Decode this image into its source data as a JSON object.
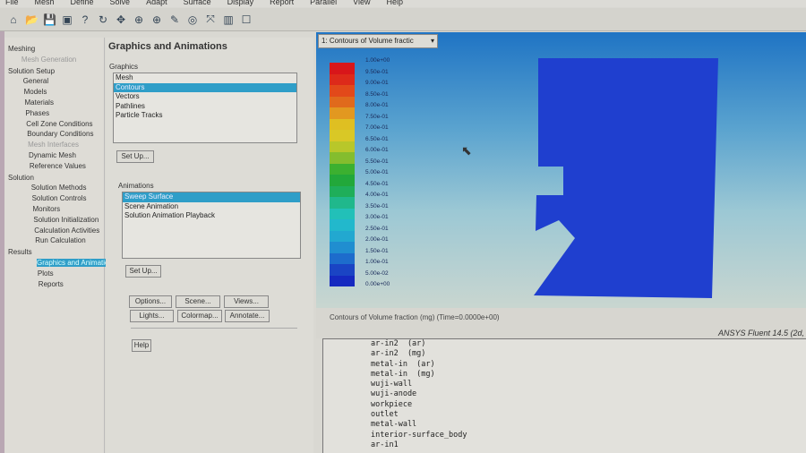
{
  "menu": [
    "File",
    "Mesh",
    "Define",
    "Solve",
    "Adapt",
    "Surface",
    "Display",
    "Report",
    "Parallel",
    "View",
    "Help"
  ],
  "toolbar_icons": [
    "home-icon",
    "open-icon",
    "save-icon",
    "image-icon",
    "help-icon",
    "rotate-icon",
    "pan-icon",
    "zoom-in-icon",
    "zoom-fit-icon",
    "probe-icon",
    "zoom-box-icon",
    "axes-icon",
    "layout-icon",
    "window-icon"
  ],
  "tree": [
    {
      "label": "Meshing",
      "level": 0
    },
    {
      "label": "Mesh Generation",
      "level": 1,
      "disabled": true
    },
    {
      "label": "Solution Setup",
      "level": 0
    },
    {
      "label": "General",
      "level": 1
    },
    {
      "label": "Models",
      "level": 1
    },
    {
      "label": "Materials",
      "level": 1
    },
    {
      "label": "Phases",
      "level": 1
    },
    {
      "label": "Cell Zone Conditions",
      "level": 1
    },
    {
      "label": "Boundary Conditions",
      "level": 1
    },
    {
      "label": "Mesh Interfaces",
      "level": 1,
      "disabled": true
    },
    {
      "label": "Dynamic Mesh",
      "level": 1
    },
    {
      "label": "Reference Values",
      "level": 1
    },
    {
      "label": "Solution",
      "level": 0
    },
    {
      "label": "Solution Methods",
      "level": 1
    },
    {
      "label": "Solution Controls",
      "level": 1
    },
    {
      "label": "Monitors",
      "level": 1
    },
    {
      "label": "Solution Initialization",
      "level": 1
    },
    {
      "label": "Calculation Activities",
      "level": 1
    },
    {
      "label": "Run Calculation",
      "level": 1
    },
    {
      "label": "Results",
      "level": 0
    },
    {
      "label": "Graphics and Animations",
      "level": 1,
      "selected": true
    },
    {
      "label": "Plots",
      "level": 1
    },
    {
      "label": "Reports",
      "level": 1
    }
  ],
  "panel": {
    "title": "Graphics and Animations",
    "graphics_label": "Graphics",
    "graphics_items": [
      "Mesh",
      "Contours",
      "Vectors",
      "Pathlines",
      "Particle Tracks"
    ],
    "graphics_selected": 1,
    "setup1": "Set Up...",
    "animations_label": "Animations",
    "animation_items": [
      "Sweep Surface",
      "Scene Animation",
      "Solution Animation Playback"
    ],
    "animation_selected": 0,
    "setup2": "Set Up...",
    "options": "Options...",
    "scene": "Scene...",
    "views": "Views...",
    "lights": "Lights...",
    "colormap": "Colormap...",
    "annotate": "Annotate...",
    "help": "Help"
  },
  "graphics": {
    "window_select": "1: Contours of Volume fractic",
    "colorbar_labels": [
      "1.00e+00",
      "9.50e-01",
      "9.00e-01",
      "8.50e-01",
      "8.00e-01",
      "7.50e-01",
      "7.00e-01",
      "6.50e-01",
      "6.00e-01",
      "5.50e-01",
      "5.00e-01",
      "4.50e-01",
      "4.00e-01",
      "3.50e-01",
      "3.00e-01",
      "2.50e-01",
      "2.00e-01",
      "1.50e-01",
      "1.00e-01",
      "5.00e-02",
      "0.00e+00"
    ],
    "colorbar_colors": [
      "#d8161a",
      "#dd2a1a",
      "#e2491a",
      "#e06a1c",
      "#e29820",
      "#dfbf22",
      "#d9c826",
      "#b8c72a",
      "#84bd2e",
      "#3cb030",
      "#22a83a",
      "#1fae5a",
      "#20b88c",
      "#22c0b8",
      "#22b8cc",
      "#22a8d0",
      "#208ed0",
      "#1d6ccc",
      "#1a44c4",
      "#1529c0"
    ],
    "domain_color": "#1f3fcf",
    "caption": "Contours of Volume fraction (mg)   (Time=0.0000e+00)",
    "version": "ANSYS Fluent 14.5 (2d,"
  },
  "console": [
    "ar-in2  (ar)",
    "ar-in2  (mg)",
    "metal-in  (ar)",
    "metal-in  (mg)",
    "wuji-wall",
    "wuji-anode",
    "workpiece",
    "outlet",
    "metal-wall",
    "interior-surface_body",
    "ar-in1"
  ]
}
